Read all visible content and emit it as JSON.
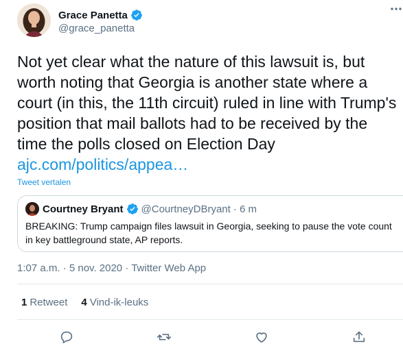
{
  "author": {
    "name": "Grace Panetta",
    "handle": "@grace_panetta"
  },
  "tweet": {
    "text": "Not yet clear what the nature of this lawsuit is, but\nworth noting that Georgia is another state where a\ncourt (in this, the 11th circuit) ruled in line with Trump's\nposition that mail ballots had to be received by the\ntime the polls closed on Election Day",
    "link": "ajc.com/politics/appea…",
    "translate_label": "Tweet vertalen"
  },
  "quote": {
    "name": "Courtney Bryant",
    "handle": "@CourtneyDBryant",
    "time": "· 6 m",
    "text": "BREAKING: Trump campaign files lawsuit in Georgia, seeking to pause the vote count in key battleground state, AP reports."
  },
  "timestamp": "1:07 a.m. · 5 nov. 2020 · Twitter Web App",
  "stats": {
    "retweets_count": "1",
    "retweets_label": "Retweet",
    "likes_count": "4",
    "likes_label": "Vind-ik-leuks"
  },
  "icons": {
    "verified": "verified-badge-icon",
    "more": "more-options-icon",
    "reply": "reply-icon",
    "retweet": "retweet-icon",
    "like": "heart-icon",
    "share": "share-icon"
  },
  "colors": {
    "link": "#1b95e0",
    "secondary_text": "#5b7083",
    "verified": "#1da1f2",
    "border": "#cfd9de"
  }
}
